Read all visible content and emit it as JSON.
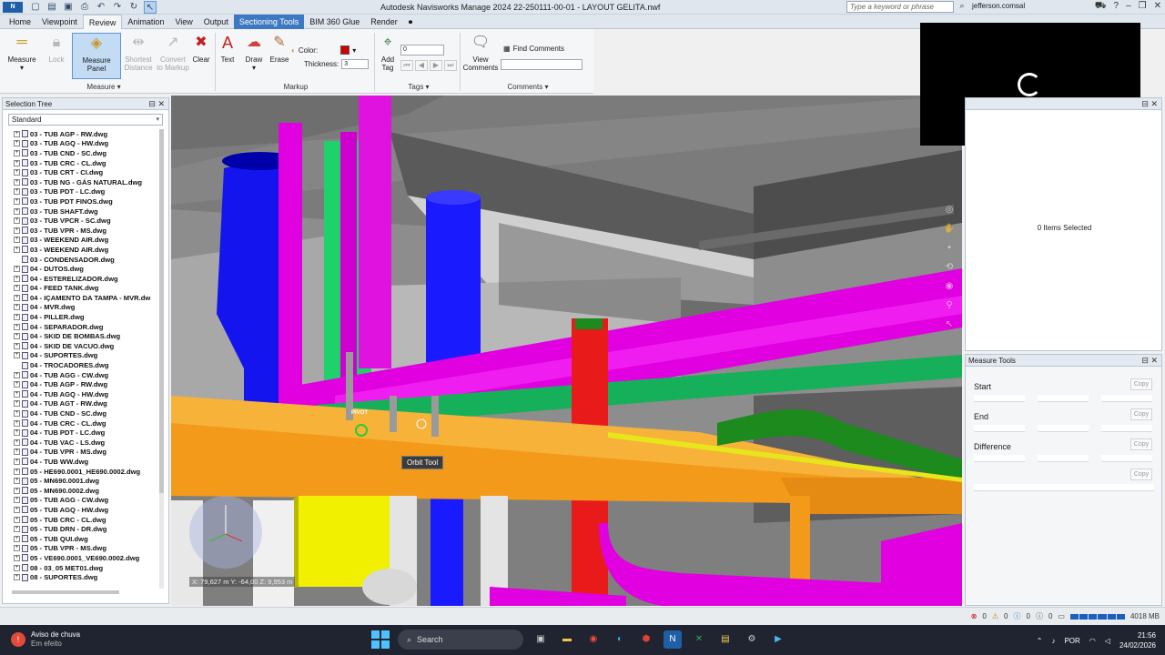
{
  "titlebar": {
    "app_icon": "N MAN",
    "title": "Autodesk Navisworks Manage 2024    22-250111-00-01 - LAYOUT GELITA.nwf",
    "search_placeholder": "Type a keyword or phrase",
    "user": "jefferson.comsal"
  },
  "tabs": [
    "Home",
    "Viewpoint",
    "Review",
    "Animation",
    "View",
    "Output",
    "Sectioning Tools",
    "BIM 360 Glue",
    "Render"
  ],
  "ribbon": {
    "measure": {
      "label": "Measure",
      "panel_btn": "Measure Panel",
      "lock": "Lock",
      "shortest1": "Shortest",
      "shortest2": "Distance",
      "convert1": "Convert",
      "convert2": "to Markup",
      "clear": "Clear",
      "panel": "Measure"
    },
    "markup": {
      "text": "Text",
      "draw": "Draw",
      "erase": "Erase",
      "color": "Color:",
      "thickness": "Thickness:",
      "thickness_value": "3",
      "panel": "Markup"
    },
    "tags": {
      "add1": "Add",
      "add2": "Tag",
      "tag_value": "0",
      "panel": "Tags"
    },
    "comments": {
      "view1": "View",
      "view2": "Comments",
      "find": "Find Comments",
      "panel": "Comments"
    }
  },
  "selection_tree": {
    "title": "Selection Tree",
    "mode": "Standard",
    "items": [
      "03 - TUB AGP - RW.dwg",
      "03 - TUB AGQ - HW.dwg",
      "03 - TUB CND - SC.dwg",
      "03 - TUB CRC - CL.dwg",
      "03 - TUB CRT - CI.dwg",
      "03 - TUB NG - GÁS NATURAL.dwg",
      "03 - TUB PDT - LC.dwg",
      "03 - TUB PDT FINOS.dwg",
      "03 - TUB SHAFT.dwg",
      "03 - TUB VPCR - SC.dwg",
      "03 - TUB VPR - MS.dwg",
      "03 - WEEKEND AIR.dwg",
      "03 - WEEKEND AIR.dwg",
      "03 - CONDENSADOR.dwg",
      "04 - DUTOS.dwg",
      "04 - ESTERELIZADOR.dwg",
      "04 - FEED TANK.dwg",
      "04 - IÇAMENTO DA TAMPA - MVR.dw",
      "04 - MVR.dwg",
      "04 - PILLER.dwg",
      "04 - SEPARADOR.dwg",
      "04 - SKID DE BOMBAS.dwg",
      "04 - SKID DE VACUO.dwg",
      "04 - SUPORTES.dwg",
      "04 - TROCADORES.dwg",
      "04 - TUB AGG - CW.dwg",
      "04 - TUB AGP - RW.dwg",
      "04 - TUB AGQ - HW.dwg",
      "04 - TUB AGT - RW.dwg",
      "04 - TUB CND - SC.dwg",
      "04 - TUB CRC - CL.dwg",
      "04 - TUB PDT - LC.dwg",
      "04 - TUB VAC - LS.dwg",
      "04 - TUB VPR - MS.dwg",
      "04 - TUB WW.dwg",
      "05 - HE690.0001_HE690.0002.dwg",
      "05 - MN690.0001.dwg",
      "05 - MN690.0002.dwg",
      "05 - TUB AGG - CW.dwg",
      "05 - TUB AGQ - HW.dwg",
      "05 - TUB CRC - CL.dwg",
      "05 - TUB DRN - DR.dwg",
      "05 - TUB QUI.dwg",
      "05 - TUB VPR - MS.dwg",
      "05 - VE690.0001_VE690.0002.dwg",
      "08 - 03_05 MET01.dwg",
      "08 - SUPORTES.dwg"
    ]
  },
  "viewport": {
    "pivot": "PIVOT",
    "tooltip": "Orbit Tool",
    "coords": "X: 79,627 m  Y: -64,00  Z: 9,953 m"
  },
  "properties": {
    "items_selected": "0 Items Selected"
  },
  "measure_tools": {
    "title": "Measure Tools",
    "start": "Start",
    "end": "End",
    "difference": "Difference",
    "copy": "Copy"
  },
  "statusbar": {
    "errors": "0",
    "warn": "0",
    "info": "0",
    "other": "0",
    "memory": "4018 MB"
  },
  "taskbar": {
    "weather_title": "Aviso de chuva",
    "weather_sub": "Em efeito",
    "search": "Search",
    "lang": "POR",
    "time": "21:56",
    "date": "24/02/2026"
  },
  "colors": {
    "accent": "#3d79c2",
    "magenta_pipe": "#e000e0",
    "blue_pipe": "#1a1aff",
    "orange_beam": "#f39a1a",
    "green_pipe": "#1c8a1c"
  }
}
